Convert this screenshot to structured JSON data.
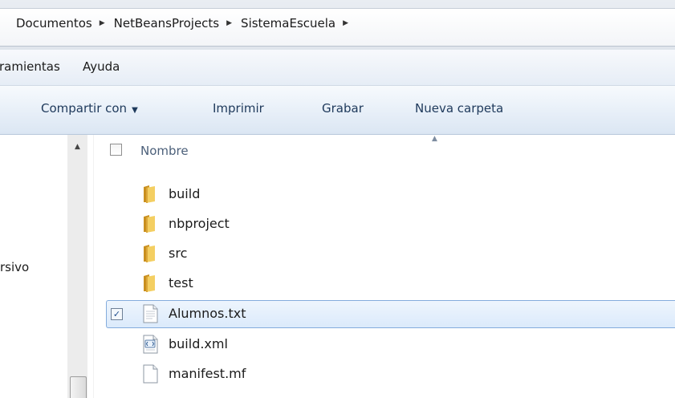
{
  "breadcrumb": {
    "items": [
      "Documentos",
      "NetBeansProjects",
      "SistemaEscuela"
    ]
  },
  "menu": {
    "items": [
      "ramientas",
      "Ayuda"
    ]
  },
  "toolbar": {
    "share_label": "Compartir con",
    "print_label": "Imprimir",
    "burn_label": "Grabar",
    "new_folder_label": "Nueva carpeta"
  },
  "nav": {
    "partial_label": "rsivo"
  },
  "filelist": {
    "column_name": "Nombre",
    "items": [
      {
        "name": "build",
        "type": "folder",
        "selected": false
      },
      {
        "name": "nbproject",
        "type": "folder",
        "selected": false
      },
      {
        "name": "src",
        "type": "folder",
        "selected": false
      },
      {
        "name": "test",
        "type": "folder",
        "selected": false
      },
      {
        "name": "Alumnos.txt",
        "type": "text-file",
        "selected": true
      },
      {
        "name": "build.xml",
        "type": "xml-file",
        "selected": false
      },
      {
        "name": "manifest.mf",
        "type": "file",
        "selected": false
      }
    ]
  },
  "colors": {
    "selection_border": "#84acdd",
    "selection_fill": "#dbeafb",
    "folder": "#e8b53b",
    "command_text": "#1e395b"
  }
}
